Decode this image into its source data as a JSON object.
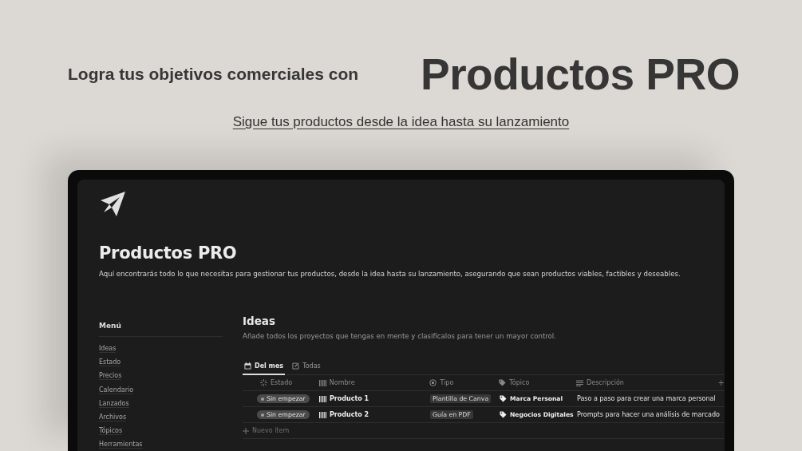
{
  "hero": {
    "lead": "Logra tus objetivos comerciales con",
    "title": "Productos PRO",
    "subtitle": "Sigue tus productos desde la idea hasta su lanzamiento"
  },
  "app": {
    "title": "Productos PRO",
    "description": "Aquí encontrarás todo lo que necesitas para gestionar tus productos, desde la idea hasta su lanzamiento, asegurando que sean productos viables, factibles y deseables.",
    "menu": {
      "heading": "Menú",
      "items": [
        "Ideas",
        "Estado",
        "Precios",
        "Calendario",
        "Lanzados",
        "Archivos",
        "Tópicos",
        "Herramientas"
      ]
    },
    "section": {
      "title": "Ideas",
      "description": "Añade todos los proyectos que tengas en mente y clasifícalos para tener un mayor control.",
      "tabs": [
        {
          "label": "Del mes",
          "selected": true
        },
        {
          "label": "Todas",
          "selected": false
        }
      ],
      "table": {
        "columns": [
          "Estado",
          "Nombre",
          "Tipo",
          "Tópico",
          "Descripción"
        ],
        "add_column": "+",
        "rows": [
          {
            "estado": "Sin empezar",
            "nombre": "Producto 1",
            "tipo": "Plantilla de Canva",
            "topico": "Marca Personal",
            "descripcion": "Paso a paso para crear una marca personal"
          },
          {
            "estado": "Sin empezar",
            "nombre": "Producto 2",
            "tipo": "Guía en PDF",
            "topico": "Negocios Digitales",
            "descripcion": "Prompts para hacer una análisis de marcado"
          }
        ],
        "new_item": "Nuevo ítem"
      }
    }
  }
}
